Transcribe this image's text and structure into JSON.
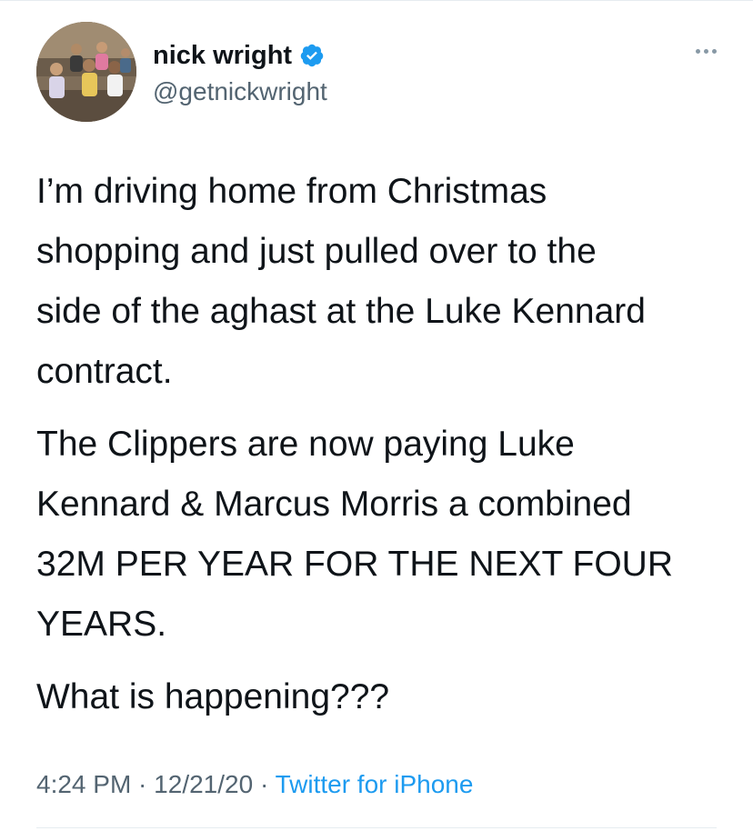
{
  "user": {
    "display_name": "nick wright",
    "handle": "@getnickwright",
    "verified": true
  },
  "tweet": {
    "paragraphs": [
      "I’m driving home from Christmas\nshopping and just pulled over to the\nside of the aghast at the Luke Kennard\ncontract.",
      "The Clippers are now paying Luke\nKennard & Marcus Morris a combined\n32M PER YEAR FOR THE NEXT FOUR\nYEARS.",
      "What is happening???"
    ],
    "time": "4:24 PM",
    "date": "12/21/20",
    "source": "Twitter for iPhone",
    "separator": " · "
  },
  "icons": {
    "verified": "verified-badge-icon",
    "more": "more-options-icon"
  },
  "colors": {
    "verified_blue": "#1d9bf0",
    "source_link": "#1d9bf0",
    "secondary_text": "#536471"
  }
}
